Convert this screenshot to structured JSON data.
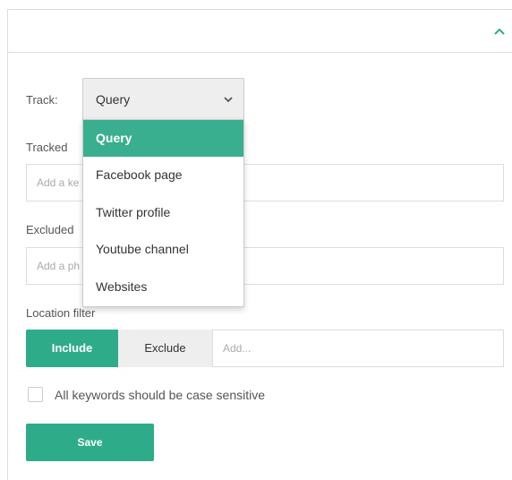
{
  "track": {
    "label": "Track:",
    "selected": "Query",
    "options": [
      "Query",
      "Facebook page",
      "Twitter profile",
      "Youtube channel",
      "Websites"
    ]
  },
  "tracked": {
    "label": "Tracked",
    "placeholder": "Add a ke"
  },
  "excluded": {
    "label": "Excluded",
    "placeholder": "Add a ph"
  },
  "location_filter": {
    "label": "Location filter",
    "include_label": "Include",
    "exclude_label": "Exclude",
    "placeholder": "Add..."
  },
  "case_sensitive": {
    "label": "All keywords should be case sensitive",
    "checked": false
  },
  "save_label": "Save",
  "colors": {
    "accent": "#2eac8a",
    "selected_option": "#3aaf8f"
  },
  "icons": {
    "collapse": "chevron-up-icon",
    "select": "chevron-down-icon"
  }
}
